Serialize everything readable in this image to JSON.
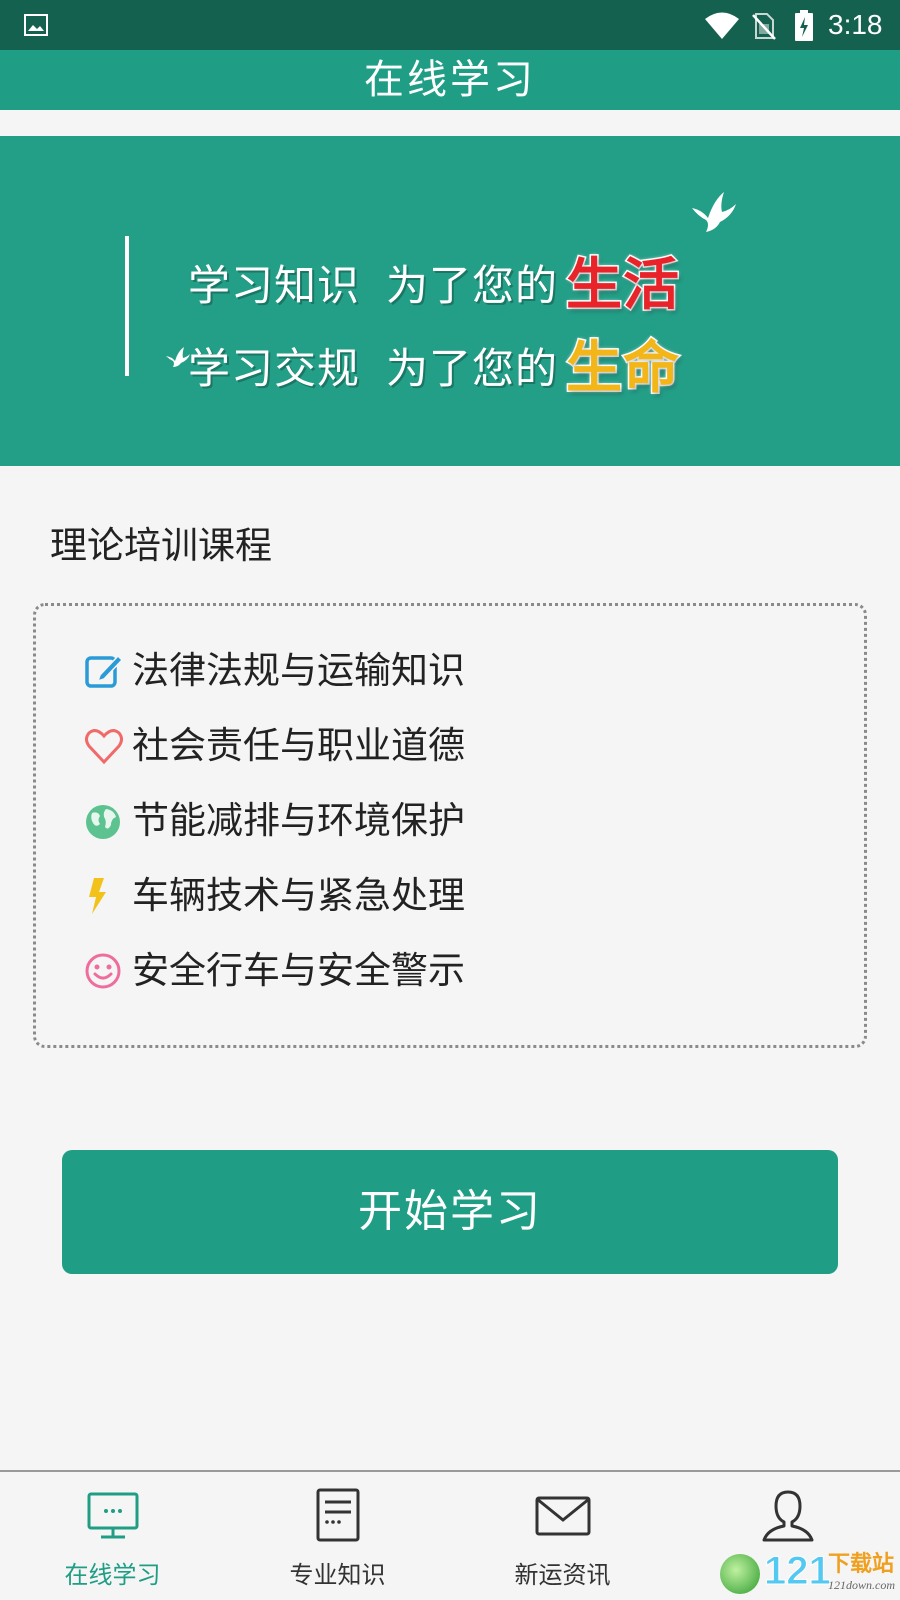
{
  "status_bar": {
    "time": "3:18",
    "icons": [
      "image-icon",
      "wifi-icon",
      "no-sim-icon",
      "battery-charging-icon"
    ]
  },
  "header": {
    "title": "在线学习"
  },
  "banner": {
    "line1_prefix": "学习知识",
    "line1_middle": "为了您的",
    "line1_highlight": "生活",
    "line2_prefix": "学习交规",
    "line2_middle": "为了您的",
    "line2_highlight": "生命",
    "colors": {
      "background": "#239e87",
      "highlight_red": "#e8232a",
      "highlight_yellow": "#f2b618"
    }
  },
  "section": {
    "title": "理论培训课程",
    "courses": [
      {
        "label": "法律法规与运输知识",
        "icon": "edit-icon",
        "color": "#2a9bd6"
      },
      {
        "label": "社会责任与职业道德",
        "icon": "heart-icon",
        "color": "#f06a6a"
      },
      {
        "label": "节能减排与环境保护",
        "icon": "globe-icon",
        "color": "#5cc28f"
      },
      {
        "label": "车辆技术与紧急处理",
        "icon": "lightning-icon",
        "color": "#f3c21a"
      },
      {
        "label": "安全行车与安全警示",
        "icon": "smile-icon",
        "color": "#ef6d9c"
      }
    ]
  },
  "start_button": {
    "label": "开始学习"
  },
  "bottom_nav": {
    "items": [
      {
        "label": "在线学习",
        "icon": "monitor-icon",
        "active": true
      },
      {
        "label": "专业知识",
        "icon": "document-icon",
        "active": false
      },
      {
        "label": "新运资讯",
        "icon": "mail-icon",
        "active": false
      },
      {
        "label": "",
        "icon": "user-icon",
        "active": false
      }
    ]
  },
  "watermark": {
    "number": "121",
    "name": "下载站",
    "sub": "121down.com"
  },
  "colors": {
    "primary": "#1f9e85",
    "status_bar": "#156150"
  }
}
